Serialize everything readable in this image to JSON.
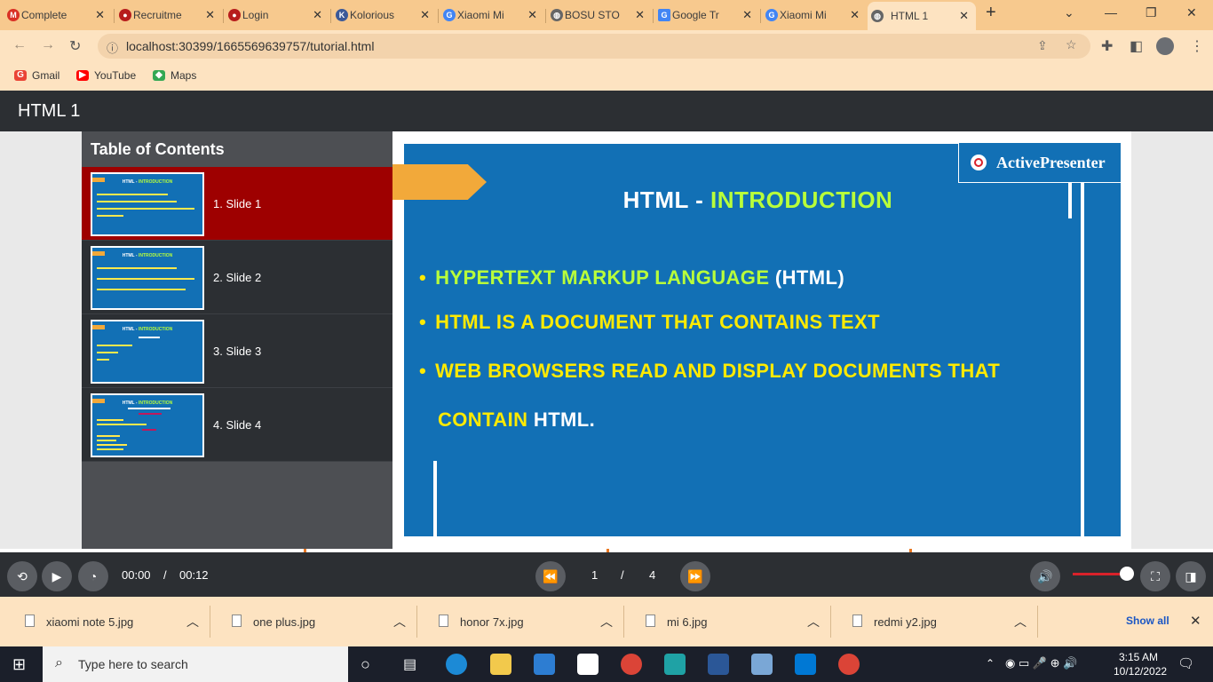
{
  "browser": {
    "tabs": [
      {
        "title": "Complete",
        "icon": "gmail-icon",
        "color": "#d93025"
      },
      {
        "title": "Recruitme",
        "icon": "site-icon",
        "color": "#b71c1c"
      },
      {
        "title": "Login",
        "icon": "site-icon",
        "color": "#b71c1c"
      },
      {
        "title": "Kolorious",
        "icon": "k-icon",
        "color": "#3b5998"
      },
      {
        "title": "Xiaomi Mi",
        "icon": "google-icon",
        "color": "#4285f4"
      },
      {
        "title": "BOSU STO",
        "icon": "globe-icon",
        "color": "#666666"
      },
      {
        "title": "Google Tr",
        "icon": "translate-icon",
        "color": "#4285f4"
      },
      {
        "title": "Xiaomi Mi",
        "icon": "google-icon",
        "color": "#4285f4"
      },
      {
        "title": "HTML 1",
        "icon": "globe-icon",
        "color": "#666666"
      }
    ],
    "url": "localhost:30399/1665569639757/tutorial.html",
    "bookmarks": [
      {
        "label": "Gmail",
        "color": "#ea4335"
      },
      {
        "label": "YouTube",
        "color": "#ff0000"
      },
      {
        "label": "Maps",
        "color": "#34a853"
      }
    ]
  },
  "page": {
    "title": "HTML 1"
  },
  "toc": {
    "title": "Table of Contents",
    "items": [
      {
        "label": "1. Slide 1",
        "thumb_title": "HTML - ",
        "thumb_hl": "INTRODUCTION"
      },
      {
        "label": "2. Slide 2",
        "thumb_title": "HTML - ",
        "thumb_hl": "INTRODUCTION"
      },
      {
        "label": "3. Slide 3",
        "thumb_title": "HTML - ",
        "thumb_hl": "INTRODUCTION"
      },
      {
        "label": "4. Slide 4",
        "thumb_title": "HTML - ",
        "thumb_hl": "INTRODUCTION"
      }
    ]
  },
  "slide": {
    "title_part1": "HTML - ",
    "title_part2": "INTRODUCTION",
    "badge": "ActivePresenter",
    "bullet1_a": "HYPERTEXT MARKUP LANGUAGE",
    "bullet1_b": "(HTML)",
    "bullet2": "HTML IS A DOCUMENT THAT CONTAINS TEXT",
    "bullet3_line1": "WEB BROWSERS READ AND DISPLAY DOCUMENTS THAT",
    "bullet3_line2_a": "CONTAIN",
    "bullet3_line2_b": "HTML."
  },
  "player": {
    "current_time": "00:00",
    "separator": "/",
    "duration": "00:12",
    "page_current": "1",
    "page_sep": "/",
    "page_total": "4",
    "volume": 0.95
  },
  "downloads": {
    "files": [
      "xiaomi note 5.jpg",
      "one plus.jpg",
      "honor 7x.jpg",
      "mi 6.jpg",
      "redmi y2.jpg"
    ],
    "show_all": "Show all"
  },
  "taskbar": {
    "search_placeholder": "Type here to search",
    "time": "3:15 AM",
    "date": "10/12/2022"
  }
}
